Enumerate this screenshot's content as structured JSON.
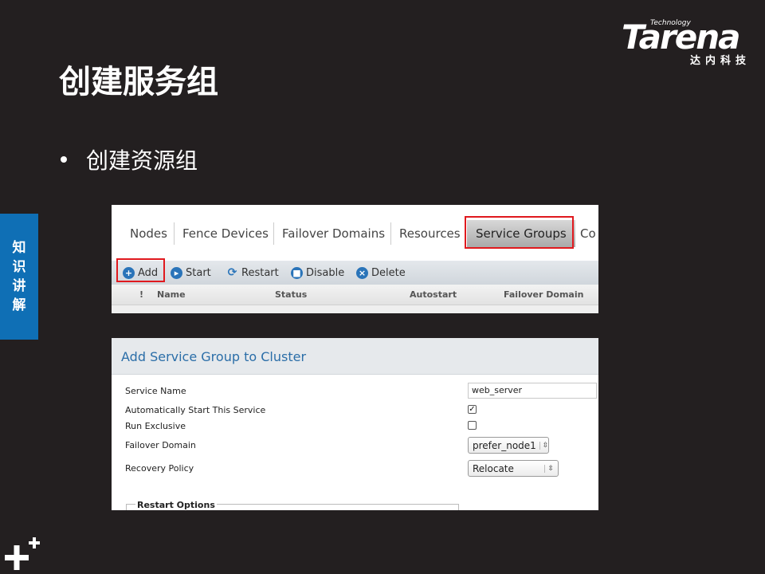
{
  "slide": {
    "title": "创建服务组",
    "bullet": "创建资源组",
    "side_tab": [
      "知",
      "识",
      "讲",
      "解"
    ]
  },
  "logo": {
    "tech": "Technology",
    "word": "Tarena",
    "cn": "达内科技"
  },
  "cluster_ui": {
    "tabs": [
      "Nodes",
      "Fence Devices",
      "Failover Domains",
      "Resources",
      "Service Groups",
      "Co"
    ],
    "active_tab": "Service Groups",
    "toolbar": {
      "add": "Add",
      "start": "Start",
      "restart": "Restart",
      "disable": "Disable",
      "delete": "Delete"
    },
    "columns": {
      "flag": "!",
      "name": "Name",
      "status": "Status",
      "autostart": "Autostart",
      "failover_domain": "Failover Domain"
    }
  },
  "add_dialog": {
    "title": "Add Service Group to Cluster",
    "labels": {
      "service_name": "Service Name",
      "auto_start": "Automatically Start This Service",
      "run_exclusive": "Run Exclusive",
      "failover_domain": "Failover Domain",
      "recovery_policy": "Recovery Policy"
    },
    "values": {
      "service_name": "web_server",
      "auto_start": true,
      "run_exclusive": false,
      "failover_domain": "prefer_node1",
      "recovery_policy": "Relocate"
    },
    "restart_options_legend": "Restart Options"
  },
  "colors": {
    "background": "#231f20",
    "side_tab": "#0f6fb5",
    "highlight": "#e0191e",
    "dialog_title": "#2b6ea8"
  }
}
